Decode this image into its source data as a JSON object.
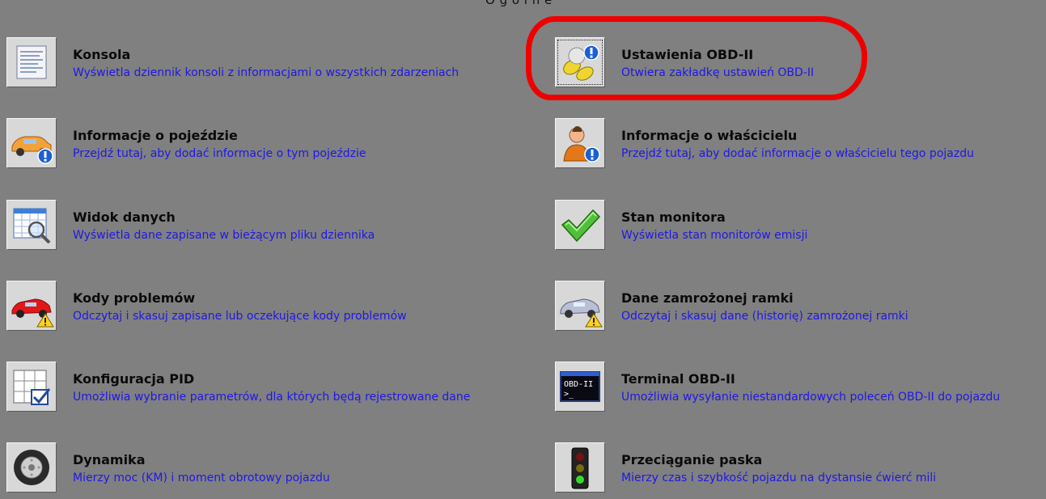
{
  "header": {
    "cut_text": "O g ó l n e"
  },
  "items_left": [
    {
      "title": "Konsola",
      "desc": "Wyświetla dziennik konsoli z informacjami o wszystkich zdarzeniach",
      "icon": "console-icon"
    },
    {
      "title": "Informacje o pojeździe",
      "desc": "Przejdź tutaj, aby dodać informacje o tym pojeździe",
      "icon": "vehicle-info-icon"
    },
    {
      "title": "Widok danych",
      "desc": "Wyświetla dane zapisane w bieżącym pliku dziennika",
      "icon": "data-view-icon"
    },
    {
      "title": "Kody problemów",
      "desc": "Odczytaj i skasuj zapisane lub oczekujące kody problemów",
      "icon": "trouble-codes-icon"
    },
    {
      "title": "Konfiguracja PID",
      "desc": "Umożliwia wybranie parametrów, dla których będą rejestrowane dane",
      "icon": "pid-config-icon"
    },
    {
      "title": "Dynamika",
      "desc": "Mierzy moc (KM) i moment obrotowy pojazdu",
      "icon": "wheel-icon"
    }
  ],
  "items_right": [
    {
      "title": "Ustawienia OBD-II",
      "desc": "Otwiera zakładkę ustawień OBD-II",
      "icon": "obd-settings-icon"
    },
    {
      "title": "Informacje o właścicielu",
      "desc": "Przejdź tutaj, aby dodać informacje o właścicielu tego pojazdu",
      "icon": "owner-info-icon"
    },
    {
      "title": "Stan monitora",
      "desc": "Wyświetla stan monitorów emisji",
      "icon": "checkmark-icon"
    },
    {
      "title": "Dane zamrożonej ramki",
      "desc": "Odczytaj i skasuj dane (historię) zamrożonej ramki",
      "icon": "freeze-frame-icon"
    },
    {
      "title": "Terminal OBD-II",
      "desc": "Umożliwia wysyłanie niestandardowych poleceń OBD-II do pojazdu",
      "icon": "terminal-icon"
    },
    {
      "title": "Przeciąganie paska",
      "desc": "Mierzy czas i szybkość pojazdu na dystansie ćwierć mili",
      "icon": "traffic-light-icon"
    }
  ],
  "terminal_icon_text": {
    "line1": "OBD-II",
    "line2": ">_"
  },
  "colors": {
    "background": "#808080",
    "desc_text": "#1e18e6",
    "highlight": "#ee0000"
  }
}
